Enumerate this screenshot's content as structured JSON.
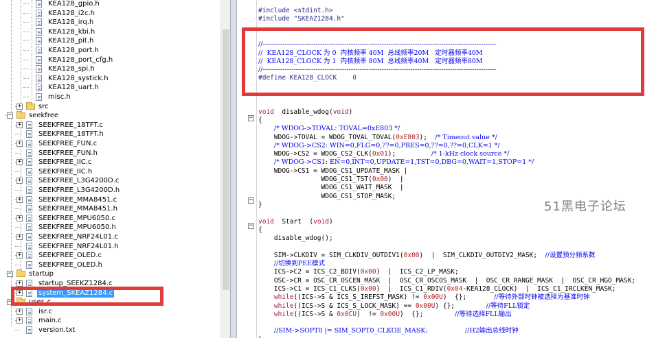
{
  "tree": {
    "items": [
      {
        "label": "KEA128_gpio.h",
        "type": "file",
        "level": 3
      },
      {
        "label": "KEA128_i2c.h",
        "type": "file",
        "level": 3
      },
      {
        "label": "KEA128_irq.h",
        "type": "file",
        "level": 3
      },
      {
        "label": "KEA128_kbi.h",
        "type": "file",
        "level": 3
      },
      {
        "label": "KEA128_pit.h",
        "type": "file",
        "level": 3
      },
      {
        "label": "KEA128_port.h",
        "type": "file",
        "level": 3
      },
      {
        "label": "KEA128_port_cfg.h",
        "type": "file",
        "level": 3
      },
      {
        "label": "KEA128_spi.h",
        "type": "file",
        "level": 3
      },
      {
        "label": "KEA128_systick.h",
        "type": "file",
        "level": 3
      },
      {
        "label": "KEA128_uart.h",
        "type": "file",
        "level": 3
      },
      {
        "label": "misc.h",
        "type": "file",
        "level": 3
      },
      {
        "label": "src",
        "type": "folder",
        "level": 2,
        "expander": "+"
      },
      {
        "label": "seekfree",
        "type": "folder",
        "level": 1,
        "expander": "-"
      },
      {
        "label": "SEEKFREE_18TFT.c",
        "type": "file",
        "level": 2,
        "expander": "+"
      },
      {
        "label": "SEEKFREE_18TFT.h",
        "type": "file",
        "level": 2
      },
      {
        "label": "SEEKFREE_FUN.c",
        "type": "file",
        "level": 2,
        "expander": "+"
      },
      {
        "label": "SEEKFREE_FUN.h",
        "type": "file",
        "level": 2
      },
      {
        "label": "SEEKFREE_IIC.c",
        "type": "file",
        "level": 2,
        "expander": "+"
      },
      {
        "label": "SEEKFREE_IIC.h",
        "type": "file",
        "level": 2
      },
      {
        "label": "SEEKFREE_L3G4200D.c",
        "type": "file",
        "level": 2,
        "expander": "+"
      },
      {
        "label": "SEEKFREE_L3G4200D.h",
        "type": "file",
        "level": 2
      },
      {
        "label": "SEEKFREE_MMA8451.c",
        "type": "file",
        "level": 2,
        "expander": "+"
      },
      {
        "label": "SEEKFREE_MMA8451.h",
        "type": "file",
        "level": 2
      },
      {
        "label": "SEEKFREE_MPU6050.c",
        "type": "file",
        "level": 2,
        "expander": "+"
      },
      {
        "label": "SEEKFREE_MPU6050.h",
        "type": "file",
        "level": 2
      },
      {
        "label": "SEEKFREE_NRF24L01.c",
        "type": "file",
        "level": 2,
        "expander": "+"
      },
      {
        "label": "SEEKFREE_NRF24L01.h",
        "type": "file",
        "level": 2
      },
      {
        "label": "SEEKFREE_OLED.c",
        "type": "file",
        "level": 2,
        "expander": "+"
      },
      {
        "label": "SEEKFREE_OLED.h",
        "type": "file",
        "level": 2
      },
      {
        "label": "startup",
        "type": "folder",
        "level": 1,
        "expander": "-"
      },
      {
        "label": "startup_SEEKZ1284.c",
        "type": "file",
        "level": 2,
        "expander": "+"
      },
      {
        "label": "system_SKEAZ1284.c",
        "type": "file",
        "level": 2,
        "expander": "+",
        "selected": true
      },
      {
        "label": "user_c",
        "type": "folder",
        "level": 1,
        "expander": "-"
      },
      {
        "label": "isr.c",
        "type": "file",
        "level": 2,
        "expander": "+"
      },
      {
        "label": "main.c",
        "type": "file",
        "level": 2,
        "expander": "+"
      },
      {
        "label": "version.txt",
        "type": "file",
        "level": 2
      }
    ]
  },
  "code": {
    "lines": [
      [
        [
          "pp",
          "#include <stdint.h>"
        ]
      ],
      [
        [
          "pp",
          "#include \"SKEAZ1284.h\""
        ]
      ],
      [],
      [],
      [
        [
          "cm",
          "//----------------------------------------------------------------------------------------------------------"
        ]
      ],
      [
        [
          "cm",
          "//  KEA128_CLOCK 为 0  内核频率 40M  总线频率20M   定时器频率40M"
        ]
      ],
      [
        [
          "cm",
          "//  KEA128_CLOCK 为 1  内核频率 80M  总线频率40M   定时器频率80M"
        ]
      ],
      [
        [
          "cm",
          "//----------------------------------------------------------------------------------------------------------"
        ]
      ],
      [
        [
          "pp",
          "#define KEA128_CLOCK    "
        ],
        [
          "num",
          "0"
        ]
      ],
      [],
      [],
      [],
      [
        [
          "kw",
          "void"
        ],
        [
          "",
          "  disable_wdog("
        ],
        [
          "kw",
          "void"
        ],
        [
          "",
          ")"
        ]
      ],
      [
        [
          "",
          "{"
        ]
      ],
      [
        [
          "",
          "    "
        ],
        [
          "cm",
          "/* WDOG->TOVAL: TOVAL=0xE803 */"
        ]
      ],
      [
        [
          "",
          "    WDOG->TOVAL = WDOG_TOVAL_TOVAL("
        ],
        [
          "num",
          "0xE803"
        ],
        [
          "",
          ");  "
        ],
        [
          "cm",
          "/* Timeout value */"
        ]
      ],
      [
        [
          "",
          "    "
        ],
        [
          "cm",
          "/* WDOG->CS2: WIN=0,FLG=0,??=0,PRES=0,??=0,??=0,CLK=1 */"
        ]
      ],
      [
        [
          "",
          "    WDOG->CS2 = WDOG_CS2_CLK("
        ],
        [
          "num",
          "0x01"
        ],
        [
          "",
          ");         "
        ],
        [
          "cm",
          "/* 1-kHz clock source */"
        ]
      ],
      [
        [
          "",
          "    "
        ],
        [
          "cm",
          "/* WDOG->CS1: EN=0,INT=0,UPDATE=1,TST=0,DBG=0,WAIT=1,STOP=1 */"
        ]
      ],
      [
        [
          "",
          "    WDOG->CS1 = WDOG_CS1_UPDATE_MASK |"
        ]
      ],
      [
        [
          "",
          "                WDOG_CS1_TST("
        ],
        [
          "num",
          "0x00"
        ],
        [
          "",
          ")  |"
        ]
      ],
      [
        [
          "",
          "                WDOG_CS1_WAIT_MASK  |"
        ]
      ],
      [
        [
          "",
          "                WDOG_CS1_STOP_MASK;"
        ]
      ],
      [
        [
          "",
          "}"
        ]
      ],
      [],
      [
        [
          "kw",
          "void"
        ],
        [
          "",
          "  Start  ("
        ],
        [
          "kw",
          "void"
        ],
        [
          "",
          ")"
        ]
      ],
      [
        [
          "",
          "{"
        ]
      ],
      [
        [
          "",
          "    disable_wdog();"
        ]
      ],
      [],
      [
        [
          "",
          "    SIM->CLKDIV = SIM_CLKDIV_OUTDIV1("
        ],
        [
          "num",
          "0x00"
        ],
        [
          "",
          ")  |  SIM_CLKDIV_OUTDIV2_MASK;  "
        ],
        [
          "cm",
          "//设置预分频系数"
        ]
      ],
      [
        [
          "",
          "    "
        ],
        [
          "cm",
          "//切换到PEE模式"
        ]
      ],
      [
        [
          "",
          "    ICS->C2 = ICS_C2_BDIV("
        ],
        [
          "num",
          "0x00"
        ],
        [
          "",
          ")  |  ICS_C2_LP_MASK;"
        ]
      ],
      [
        [
          "",
          "    OSC->CR = OSC_CR_OSCEN_MASK  |  OSC_CR_OSCOS_MASK  |  OSC_CR_RANGE_MASK  |  OSC_CR_HGO_MASK;"
        ]
      ],
      [
        [
          "",
          "    ICS->C1 = ICS_C1_CLKS("
        ],
        [
          "num",
          "0x00"
        ],
        [
          "",
          ")  |  ICS_C1_RDIV("
        ],
        [
          "num",
          "0x04"
        ],
        [
          "",
          "-KEA128_CLOCK)  |  ICS_C1_IRCLKEN_MASK;"
        ]
      ],
      [
        [
          "",
          "    "
        ],
        [
          "kw",
          "while"
        ],
        [
          "",
          "((ICS->S & ICS_S_IREFST_MASK) != "
        ],
        [
          "num",
          "0x00U"
        ],
        [
          "",
          ")  {};       "
        ],
        [
          "cm",
          "//等待外部时钟被选择为基准时钟"
        ]
      ],
      [
        [
          "",
          "    "
        ],
        [
          "kw",
          "while"
        ],
        [
          "",
          "((ICS->S & ICS_S_LOCK_MASK) == "
        ],
        [
          "num",
          "0x00U"
        ],
        [
          "",
          ") {};        "
        ],
        [
          "cm",
          "//等待FLL锁定"
        ]
      ],
      [
        [
          "",
          "    "
        ],
        [
          "kw",
          "while"
        ],
        [
          "",
          "((ICS->S & "
        ],
        [
          "num",
          "0x0CU"
        ],
        [
          "",
          ")  != "
        ],
        [
          "num",
          "0x00U"
        ],
        [
          "",
          ")  {};        "
        ],
        [
          "cm",
          "//等待选择FLL输出"
        ]
      ],
      [],
      [
        [
          "",
          "    "
        ],
        [
          "cm",
          "//SIM->SOPT0 |= SIM_SOPT0_CLKOE_MASK;                  //H2输出总线时钟"
        ]
      ],
      [
        [
          "",
          "}"
        ]
      ]
    ]
  },
  "watermark": "51黑电子论坛"
}
